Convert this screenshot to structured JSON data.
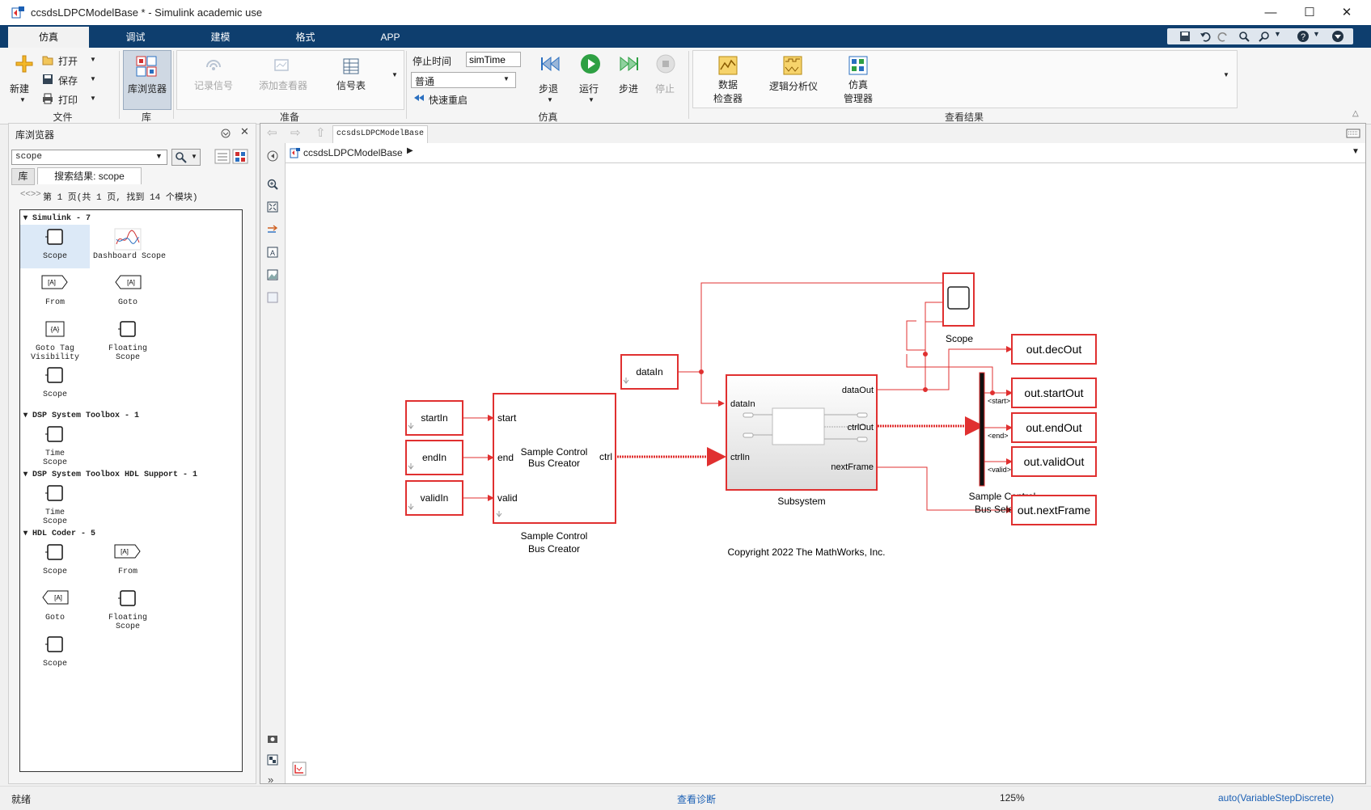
{
  "window": {
    "title": "ccsdsLDPCModelBase * - Simulink academic use"
  },
  "tabs": [
    "仿真",
    "调试",
    "建模",
    "格式",
    "APP"
  ],
  "ribbon": {
    "file": {
      "new": "新建",
      "open": "打开",
      "save": "保存",
      "print": "打印",
      "section": "文件"
    },
    "library": {
      "browser": "库浏览器",
      "section": "库"
    },
    "prepare": {
      "log_signals": "记录信号",
      "add_viewer": "添加查看器",
      "signal_table": "信号表",
      "section": "准备"
    },
    "simulate": {
      "stop_time_label": "停止时间",
      "stop_time_value": "simTime",
      "mode": "普通",
      "fast_restart": "快速重启",
      "step_back": "步退",
      "run": "运行",
      "step_forward": "步进",
      "stop": "停止",
      "section": "仿真"
    },
    "review": {
      "data_inspector_1": "数据",
      "data_inspector_2": "检查器",
      "logic_analyzer": "逻辑分析仪",
      "sim_manager_1": "仿真",
      "sim_manager_2": "管理器",
      "section": "查看结果"
    }
  },
  "library_browser": {
    "title": "库浏览器",
    "search_value": "scope",
    "tab_lib": "库",
    "tab_results": "搜索结果: scope",
    "pager": "第 1 页(共 1 页, 找到 14 个模块)",
    "groups": [
      {
        "name": "Simulink - 7",
        "items": [
          {
            "label": "Scope",
            "icon": "scope"
          },
          {
            "label": "Dashboard Scope",
            "icon": "dashboard-scope"
          },
          {
            "label": "From",
            "icon": "from"
          },
          {
            "label": "Goto",
            "icon": "goto"
          },
          {
            "label": "Goto Tag\nVisibility",
            "icon": "goto-tag"
          },
          {
            "label": "Floating\nScope",
            "icon": "scope"
          },
          {
            "label": "Scope",
            "icon": "scope"
          }
        ]
      },
      {
        "name": "DSP System Toolbox - 1",
        "items": [
          {
            "label": "Time\nScope",
            "icon": "scope"
          }
        ]
      },
      {
        "name": "DSP System Toolbox HDL Support - 1",
        "items": [
          {
            "label": "Time\nScope",
            "icon": "scope"
          }
        ]
      },
      {
        "name": "HDL Coder - 5",
        "items": [
          {
            "label": "Scope",
            "icon": "scope"
          },
          {
            "label": "From",
            "icon": "from"
          },
          {
            "label": "Goto",
            "icon": "goto"
          },
          {
            "label": "Floating\nScope",
            "icon": "scope"
          },
          {
            "label": "Scope",
            "icon": "scope"
          }
        ]
      }
    ]
  },
  "editor": {
    "model_tab": "ccsdsLDPCModelBase",
    "breadcrumb": "ccsdsLDPCModelBase",
    "blocks": {
      "startIn": "startIn",
      "endIn": "endIn",
      "validIn": "validIn",
      "dataIn": "dataIn",
      "bus_creator_ports": [
        "start",
        "end",
        "valid"
      ],
      "bus_creator_out": "ctrl",
      "bus_creator_text": "Sample Control\nBus Creator",
      "bus_creator_label": "Sample Control\nBus Creator",
      "subsystem_in": [
        "dataIn",
        "ctrlIn"
      ],
      "subsystem_out": [
        "dataOut",
        "ctrlOut",
        "nextFrame"
      ],
      "subsystem_label": "Subsystem",
      "scope_label": "Scope",
      "selector_ports": [
        "<start>",
        "<end>",
        "<valid>"
      ],
      "selector_label": "Sample Control\nBus Selector",
      "outports": [
        "out.decOut",
        "out.startOut",
        "out.endOut",
        "out.validOut",
        "out.nextFrame"
      ],
      "copyright": "Copyright 2022 The MathWorks, Inc."
    }
  },
  "statusbar": {
    "ready": "就绪",
    "diagnostics": "查看诊断",
    "zoom": "125%",
    "solver": "auto(VariableStepDiscrete)"
  },
  "colors": {
    "accent": "#0e3e6e",
    "signal": "#e03030",
    "link": "#1a5fb4"
  }
}
